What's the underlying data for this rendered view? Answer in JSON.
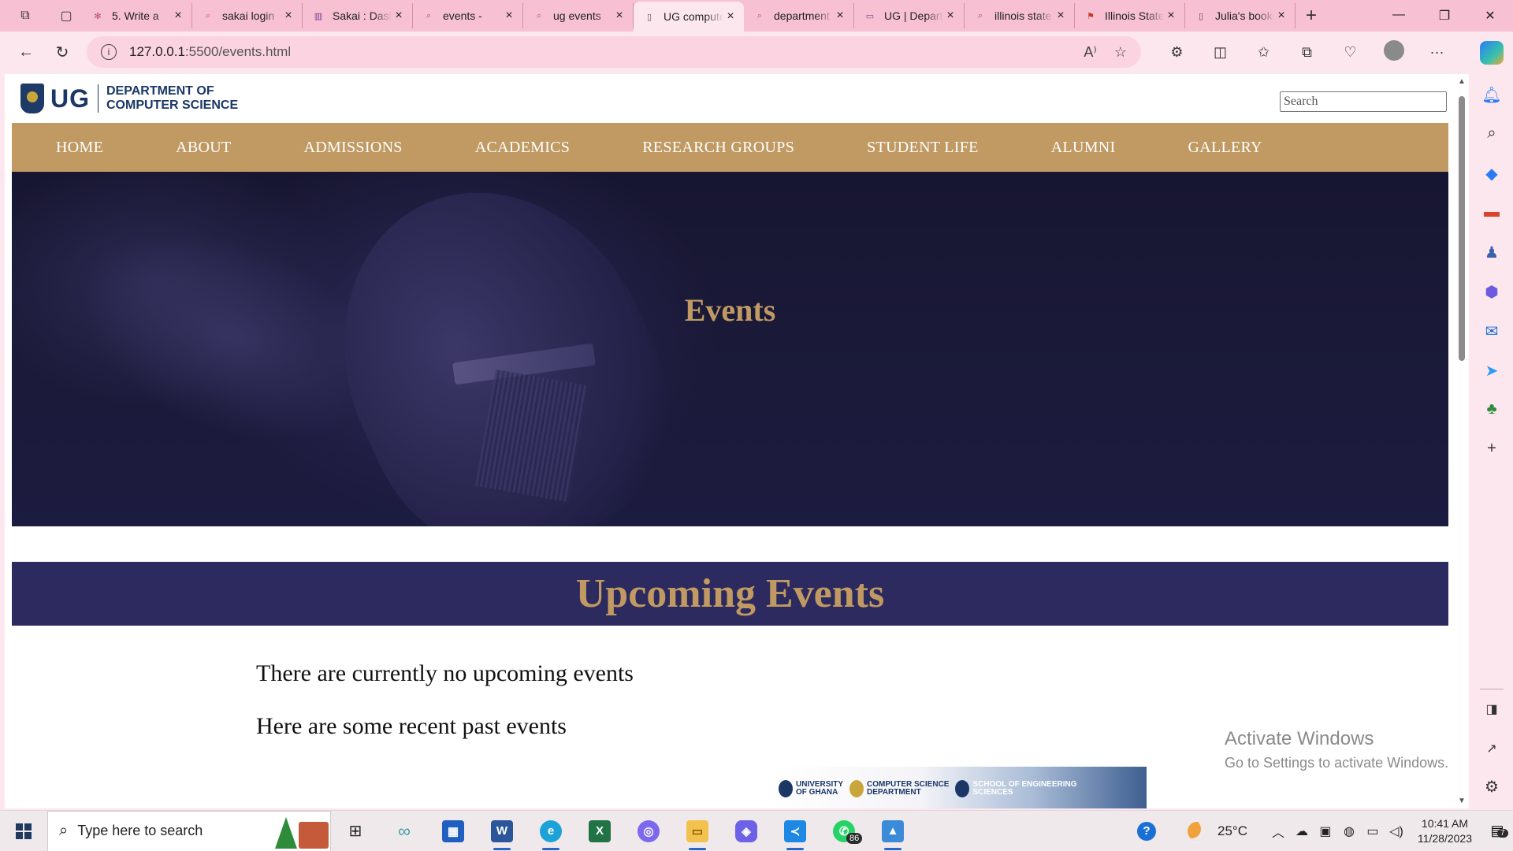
{
  "browser": {
    "tabs": [
      {
        "title": "5. Write a",
        "icon": "site-icon",
        "color": "#c0486e"
      },
      {
        "title": "sakai login",
        "icon": "search-icon",
        "color": "#c0486e"
      },
      {
        "title": "Sakai : Dashboard",
        "icon": "sakai-icon",
        "color": "#7a3b8c"
      },
      {
        "title": "events - ",
        "icon": "search-icon",
        "color": "#c0486e"
      },
      {
        "title": "ug events",
        "icon": "search-icon",
        "color": "#c0486e"
      },
      {
        "title": "UG computer science",
        "icon": "page-icon",
        "color": "#555555",
        "active": true
      },
      {
        "title": "department",
        "icon": "search-icon",
        "color": "#c0486e"
      },
      {
        "title": "UG | Department",
        "icon": "ug-icon",
        "color": "#7a3b8c"
      },
      {
        "title": "illinois state",
        "icon": "search-icon",
        "color": "#c0486e"
      },
      {
        "title": "Illinois State",
        "icon": "flag-icon",
        "color": "#c23a2a"
      },
      {
        "title": "Julia's books",
        "icon": "page-icon",
        "color": "#555555"
      }
    ],
    "url_host": "127.0.0.1",
    "url_rest": ":5500/events.html",
    "accent": "#f7c0d3"
  },
  "site": {
    "logo_ug": "UG",
    "logo_line1": "DEPARTMENT OF",
    "logo_line2": "COMPUTER SCIENCE",
    "search_placeholder": "Search",
    "nav": [
      "HOME",
      "ABOUT",
      "ADMISSIONS",
      "ACADEMICS",
      "RESEARCH GROUPS",
      "STUDENT LIFE",
      "ALUMNI",
      "GALLERY"
    ],
    "hero_title": "Events",
    "section_title": "Upcoming Events",
    "text_no_events": "There are currently no upcoming events",
    "text_past_events": "Here are some recent past events",
    "banner": {
      "uni": [
        "UNIVERSITY",
        "OF GHANA"
      ],
      "dept": [
        "COMPUTER SCIENCE",
        "DEPARTMENT"
      ],
      "school": [
        "SCHOOL OF ENGINEERING",
        "SCIENCES"
      ]
    },
    "colors": {
      "gold": "#c09a62",
      "navy": "#2c2a5e"
    }
  },
  "watermark": {
    "line1": "Activate Windows",
    "line2": "Go to Settings to activate Windows."
  },
  "taskbar": {
    "search_placeholder": "Type here to search",
    "whatsapp_badge": "86",
    "temperature": "25°C",
    "time": "10:41 AM",
    "date": "11/28/2023",
    "notification_count": "7"
  }
}
